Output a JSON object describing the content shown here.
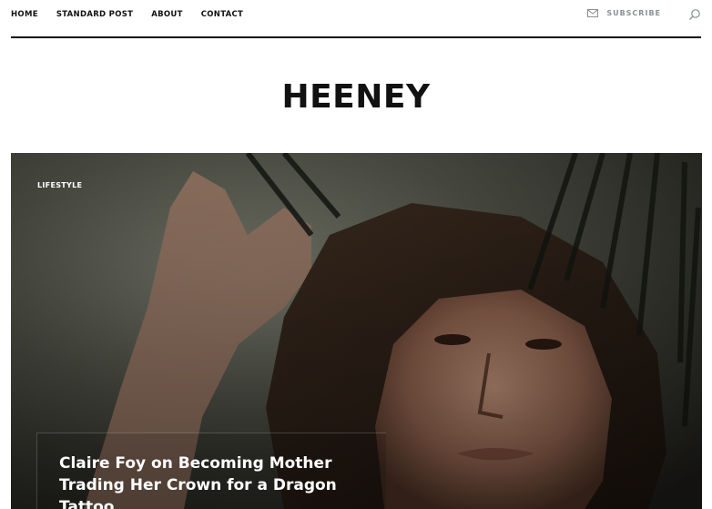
{
  "nav": {
    "items": [
      {
        "label": "HOME"
      },
      {
        "label": "STANDARD POST"
      },
      {
        "label": "ABOUT"
      },
      {
        "label": "CONTACT"
      }
    ],
    "subscribe_label": "SUBSCRIBE",
    "subscribe_icon": "mail-icon",
    "search_icon": "search-icon"
  },
  "site": {
    "title": "HEENEY"
  },
  "featured_post": {
    "category": "LIFESTYLE",
    "headline": "Claire Foy on Becoming Mother Trading Her Crown for a Dragon Tattoo"
  }
}
